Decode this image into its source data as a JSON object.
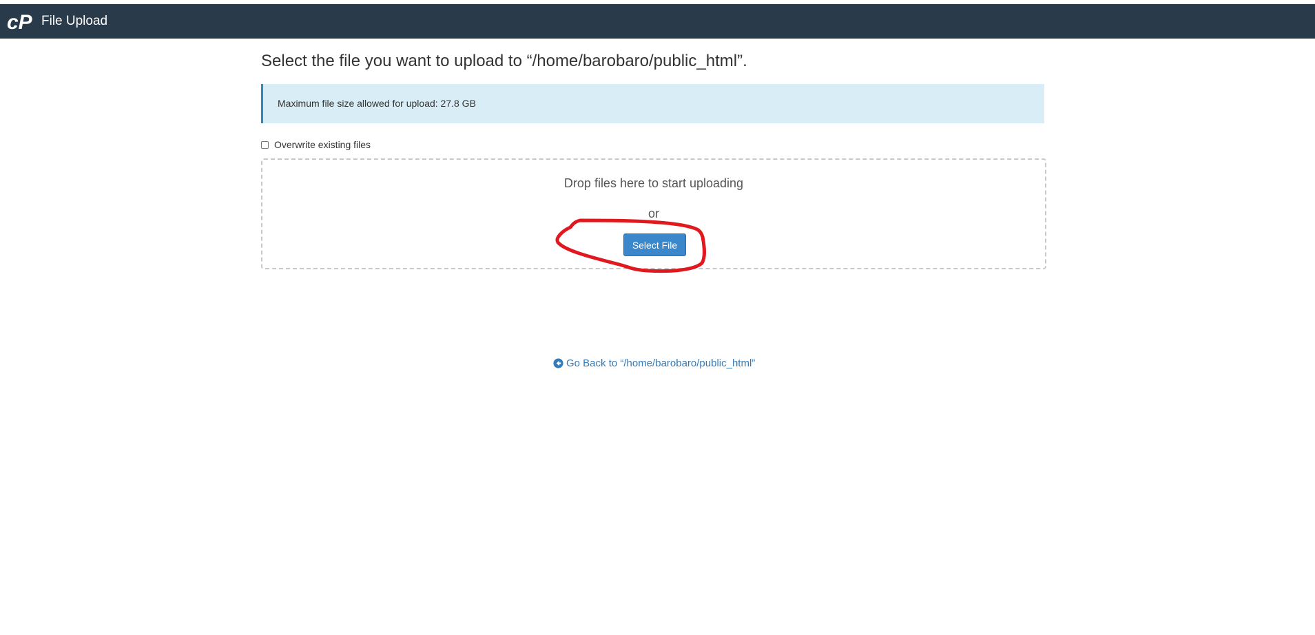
{
  "header": {
    "logo": "cpanel-logo",
    "title": "File Upload"
  },
  "main": {
    "title": "Select the file you want to upload to “/home/barobaro/public_html”.",
    "alert": "Maximum file size allowed for upload: 27.8 GB",
    "overwrite": {
      "label": "Overwrite existing files",
      "checked": false
    },
    "dropzone": {
      "drop_text": "Drop files here to start uploading",
      "or_text": "or",
      "button_label": "Select File"
    },
    "back_link": {
      "icon": "arrow-circle-left-icon",
      "label": "Go Back to “/home/barobaro/public_html”"
    }
  },
  "colors": {
    "topbar": "#293a4a",
    "button": "#3a87cc",
    "alert_bg": "#d9edf7",
    "link": "#337ab7",
    "annotation": "#e0191f"
  }
}
